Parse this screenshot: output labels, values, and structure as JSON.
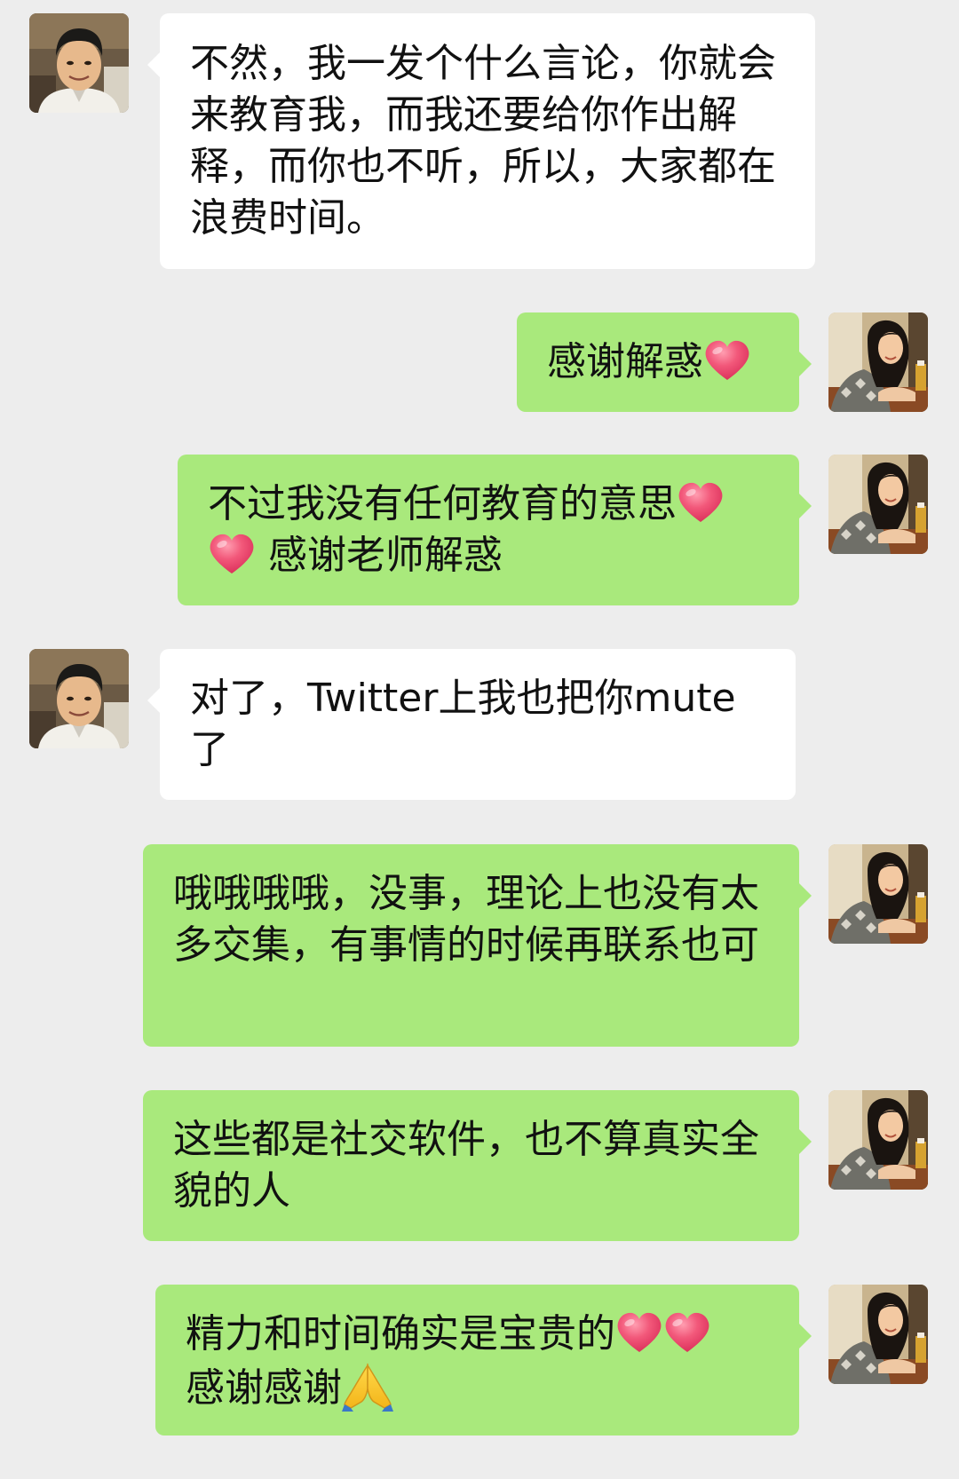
{
  "messages": [
    {
      "side": "in",
      "text": "不然，我一发个什么言论，你就会来教育我，而我还要给你作出解释，而你也不听，所以，大家都在浪费时间。"
    },
    {
      "side": "out",
      "text": "感谢解惑",
      "emoji": [
        "heart"
      ]
    },
    {
      "side": "out",
      "text_a": "不过我没有任何教育的意思",
      "text_b": "感谢老师解惑",
      "emoji": [
        "heart",
        "heart"
      ]
    },
    {
      "side": "in",
      "text": "对了，Twitter上我也把你mute了"
    },
    {
      "side": "out",
      "text": "哦哦哦哦，没事，理论上也没有太多交集，有事情的时候再联系也可"
    },
    {
      "side": "out",
      "text": "这些都是社交软件，也不算真实全貌的人"
    },
    {
      "side": "out",
      "text_a": "精力和时间确实是宝贵的",
      "text_b": "感谢感谢",
      "emoji": [
        "heart",
        "heart",
        "folded-hands"
      ]
    }
  ],
  "colors": {
    "background": "#ededed",
    "incoming_bubble": "#ffffff",
    "outgoing_bubble": "#a9e97c",
    "heart": "#ef4d6d"
  },
  "icons": {
    "heart": "heart-emoji",
    "folded_hands": "folded-hands-emoji",
    "avatar_incoming": "avatar-man",
    "avatar_outgoing": "avatar-woman"
  }
}
